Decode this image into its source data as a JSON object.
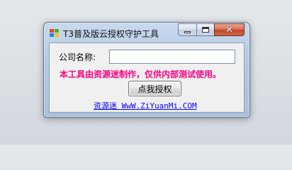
{
  "window": {
    "title": "T3普及版云授权守护工具",
    "controls": {
      "minimize": "minimize-icon",
      "maximize": "maximize-icon",
      "close": "close-icon"
    }
  },
  "form": {
    "company_label": "公司名称:",
    "company_value": "",
    "notice": "本工具由资源迷制作，仅供内部测试使用。",
    "authorize_button": "点我授权",
    "link_text": "资源迷 WwW.ZiYuanMi.COM"
  },
  "colors": {
    "notice": "#ff0080",
    "link": "#0000ff"
  }
}
